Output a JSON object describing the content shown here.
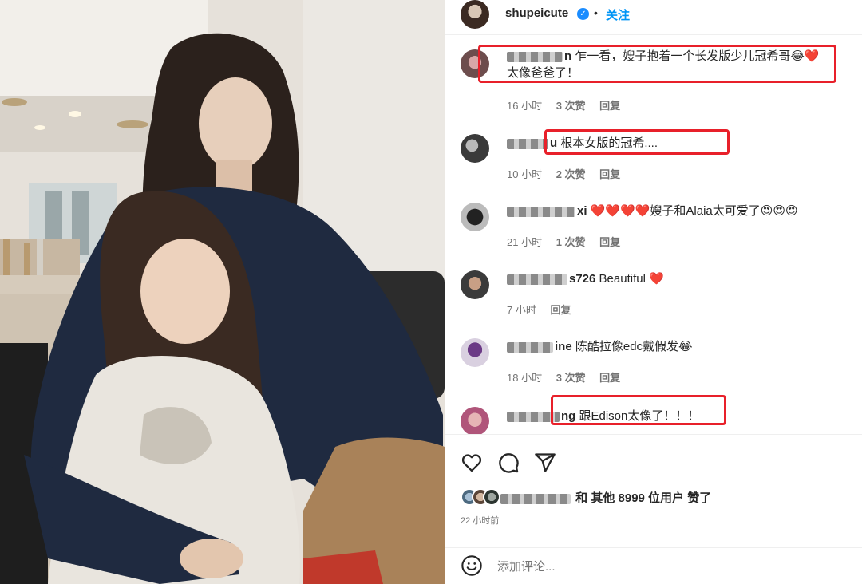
{
  "post": {
    "username": "shupeicute",
    "verified": "✓",
    "separator": "•",
    "follow_label": "关注"
  },
  "comments": [
    {
      "user": "n",
      "text": "乍一看，嫂子抱着一个长发版少儿冠希哥😂❤️",
      "text2": "太像爸爸了！",
      "time": "16 小时",
      "likes": "3 次赞",
      "reply": "回复"
    },
    {
      "user": "u",
      "text": "根本女版的冠希....",
      "time": "10 小时",
      "likes": "2 次赞",
      "reply": "回复"
    },
    {
      "user": "xi",
      "text": "❤️❤️❤️❤️嫂子和Alaia太可爱了😍😍😍",
      "time": "21 小时",
      "likes": "1 次赞",
      "reply": "回复"
    },
    {
      "user": "s726",
      "text": "Beautiful ❤️",
      "time": "7 小时",
      "reply": "回复"
    },
    {
      "user": "ine",
      "text": "陈酷拉像edc戴假发😂",
      "time": "18 小时",
      "likes": "3 次赞",
      "reply": "回复"
    },
    {
      "user": "ng",
      "text": "跟Edison太像了！！！"
    }
  ],
  "likes_line": {
    "prefix": "和 其他 8999 位用户 赞了"
  },
  "time_ago": "22 小时前",
  "add_comment": {
    "placeholder": "添加评论..."
  },
  "icons": [
    "heart-icon",
    "comment-icon",
    "share-icon",
    "emoji-icon",
    "verified-icon"
  ],
  "colors": {
    "accent": "#0095f6",
    "highlight": "#e8202a",
    "heart": "#ed2a39"
  }
}
